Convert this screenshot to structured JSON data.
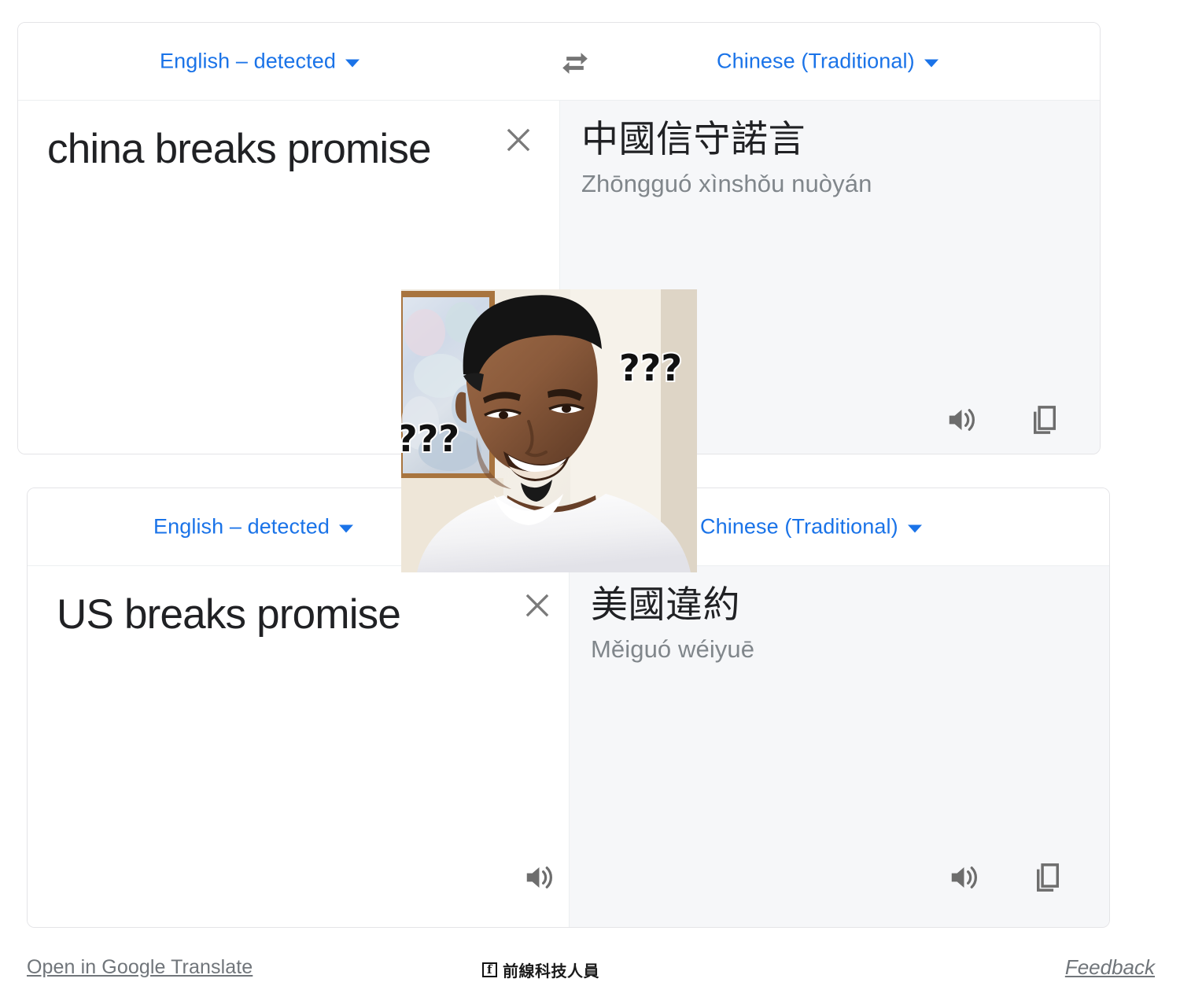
{
  "panels": [
    {
      "source_lang": "English – detected",
      "target_lang": "Chinese (Traditional)",
      "source_text": "china breaks promise",
      "target_text": "中國信守諾言",
      "transliteration": "Zhōngguó xìnshǒu nuòyán",
      "has_source_listen": false,
      "has_target_listen": true,
      "has_copy": true
    },
    {
      "source_lang": "English – detected",
      "target_lang": "Chinese (Traditional)",
      "source_text": "US breaks promise",
      "target_text": "美國違約",
      "transliteration": "Měiguó wéiyuē",
      "has_source_listen": true,
      "has_target_listen": true,
      "has_copy": true
    }
  ],
  "icons": {
    "swap": "swap-horizontal-icon",
    "clear": "close-icon",
    "listen": "speaker-icon",
    "copy": "copy-icon",
    "caret": "chevron-down-icon",
    "facebook": "facebook-icon"
  },
  "overlay": {
    "meme_name": "nick-young-confused-meme",
    "meme_text_left": "???",
    "meme_text_right": "???"
  },
  "footer": {
    "open_in_google_translate": "Open in Google Translate",
    "feedback": "Feedback",
    "watermark": "前線科技人員",
    "facebook_glyph": "f"
  },
  "colors": {
    "link_blue": "#1a73e8",
    "text_primary": "#202124",
    "text_muted": "#80868b",
    "panel_border": "#e4e4e7",
    "target_bg": "#f6f7f9"
  }
}
